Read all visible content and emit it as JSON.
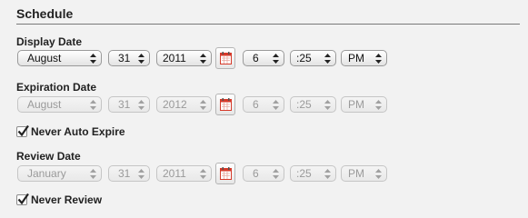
{
  "section": {
    "title": "Schedule"
  },
  "display": {
    "label": "Display Date",
    "month": "August",
    "day": "31",
    "year": "2011",
    "hour": "6",
    "minute": ":25",
    "ampm": "PM"
  },
  "expiration": {
    "label": "Expiration Date",
    "month": "August",
    "day": "31",
    "year": "2012",
    "hour": "6",
    "minute": ":25",
    "ampm": "PM",
    "never_label": "Never Auto Expire",
    "never_checked": true
  },
  "review": {
    "label": "Review Date",
    "month": "January",
    "day": "31",
    "year": "2011",
    "hour": "6",
    "minute": ":25",
    "ampm": "PM",
    "never_label": "Never Review",
    "never_checked": true
  },
  "icons": {
    "calendar": "calendar-icon",
    "select_arrows": "updown-arrows-icon",
    "checkmark": "checkmark-icon"
  },
  "colors": {
    "calendar_red": "#d63a2a",
    "background": "#f2f2f2"
  }
}
